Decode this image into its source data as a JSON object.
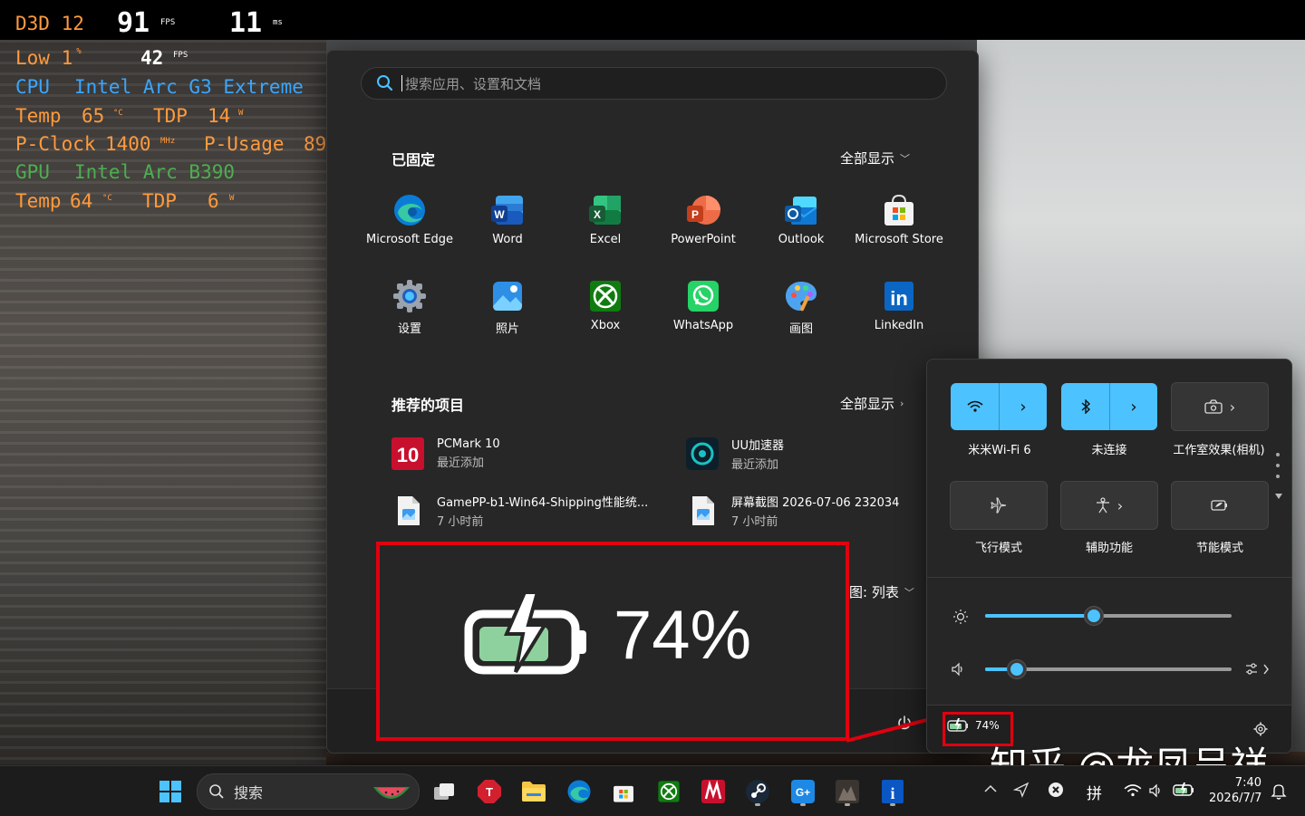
{
  "osd": {
    "api": "D3D 12",
    "fps": "91",
    "fps_unit": "FPS",
    "frametime": "11",
    "frametime_unit": "ms",
    "low_label": "Low 1",
    "low_unit": "%",
    "low_fps": "42",
    "low_fps_unit": "FPS",
    "cpu_label": "CPU",
    "cpu_name": "Intel Arc G3 Extreme",
    "temp_label": "Temp",
    "cpu_temp": "65",
    "temp_unit": "°C",
    "tdp_label": "TDP",
    "cpu_tdp": "14",
    "tdp_unit": "W",
    "pclock_label": "P-Clock",
    "pclock": "1400",
    "pclock_unit": "MHz",
    "pusage_label": "P-Usage",
    "pusage": "89",
    "gpu_label": "GPU",
    "gpu_name": "Intel Arc B390",
    "gpu_temp": "64",
    "gpu_tdp": "6"
  },
  "start_menu": {
    "search_placeholder": "搜索应用、设置和文档",
    "pinned_title": "已固定",
    "pinned_show_all": "全部显示",
    "pinned_apps": [
      {
        "label": "Microsoft Edge",
        "icon": "edge-icon"
      },
      {
        "label": "Word",
        "icon": "word-icon"
      },
      {
        "label": "Excel",
        "icon": "excel-icon"
      },
      {
        "label": "PowerPoint",
        "icon": "powerpoint-icon"
      },
      {
        "label": "Outlook",
        "icon": "outlook-icon"
      },
      {
        "label": "Microsoft Store",
        "icon": "store-icon"
      },
      {
        "label": "设置",
        "icon": "gear-icon"
      },
      {
        "label": "照片",
        "icon": "photos-icon"
      },
      {
        "label": "Xbox",
        "icon": "xbox-icon"
      },
      {
        "label": "WhatsApp",
        "icon": "whatsapp-icon"
      },
      {
        "label": "画图",
        "icon": "paint-icon"
      },
      {
        "label": "LinkedIn",
        "icon": "linkedin-icon"
      }
    ],
    "recommended_title": "推荐的项目",
    "recommended_show_all": "全部显示",
    "recommended": [
      {
        "title": "PCMark 10",
        "subtitle": "最近添加",
        "icon": "pcmark-icon"
      },
      {
        "title": "UU加速器",
        "subtitle": "最近添加",
        "icon": "uu-icon"
      },
      {
        "title": "GamePP-b1-Win64-Shipping性能统...",
        "subtitle": "7 小时前",
        "icon": "image-file-icon"
      },
      {
        "title": "屏幕截图 2026-07-06 232034",
        "subtitle": "7 小时前",
        "icon": "image-file-icon"
      }
    ],
    "view_toggle": "图: 列表"
  },
  "callout": {
    "battery_text": "74%"
  },
  "quick_settings": {
    "tiles": [
      {
        "label": "米米Wi-Fi 6",
        "state": "on",
        "icon": "wifi-icon"
      },
      {
        "label": "未连接",
        "state": "on",
        "icon": "bluetooth-icon"
      },
      {
        "label": "工作室效果(相机)",
        "state": "off",
        "icon": "camera-effects-icon"
      },
      {
        "label": "飞行模式",
        "state": "off",
        "icon": "airplane-icon"
      },
      {
        "label": "辅助功能",
        "state": "off",
        "icon": "accessibility-icon"
      },
      {
        "label": "节能模式",
        "state": "off",
        "icon": "energy-saver-icon"
      }
    ],
    "brightness": 0.44,
    "volume": 0.13,
    "battery": "74%"
  },
  "watermark": "知乎 @龙凤呈祥",
  "taskbar": {
    "search_label": "搜索",
    "ime": "拼",
    "time": "7:40",
    "date": "2026/7/7"
  },
  "colors": {
    "accent": "#4cc2ff",
    "callout_red": "#e0000f",
    "osd_orange": "#ff9a3d",
    "osd_blue": "#3aa6ff",
    "osd_green": "#4caf50"
  }
}
